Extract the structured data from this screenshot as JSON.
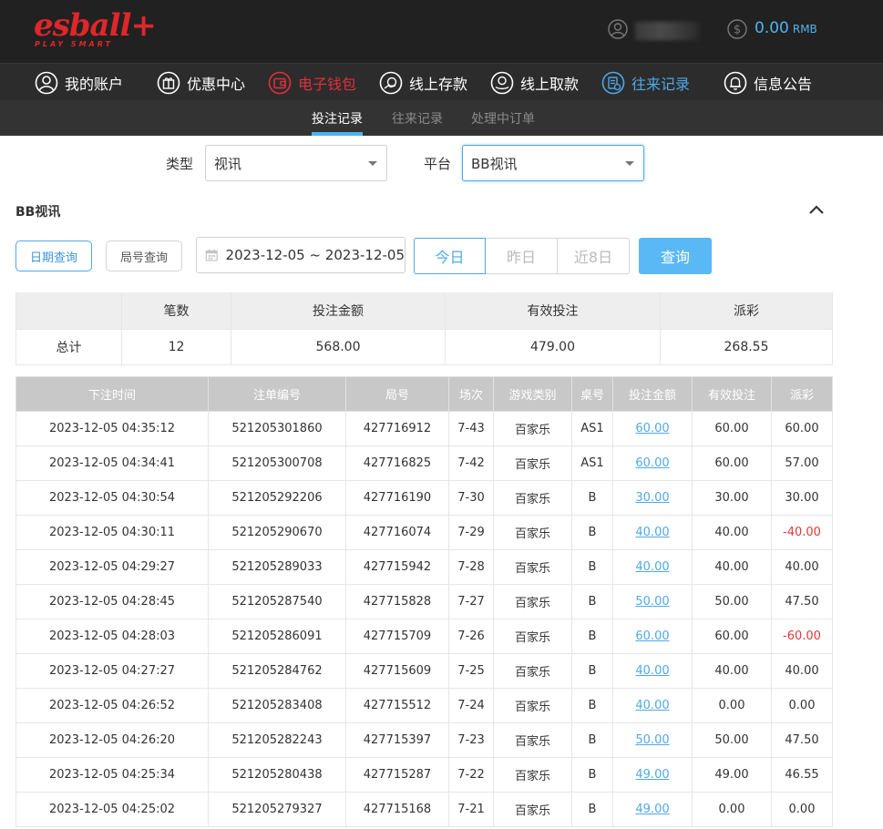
{
  "header": {
    "logo_main": "esball+",
    "logo_sub": "PLAY SMART",
    "balance": "0.00",
    "currency": "RMB"
  },
  "nav": {
    "items": [
      {
        "label": "我的账户",
        "icon": "user-circle-icon"
      },
      {
        "label": "优惠中心",
        "icon": "gift-icon"
      },
      {
        "label": "电子钱包",
        "icon": "wallet-icon"
      },
      {
        "label": "线上存款",
        "icon": "deposit-icon"
      },
      {
        "label": "线上取款",
        "icon": "withdraw-icon"
      },
      {
        "label": "往来记录",
        "icon": "records-icon"
      },
      {
        "label": "信息公告",
        "icon": "bell-icon"
      }
    ]
  },
  "subnav": {
    "items": [
      {
        "label": "投注记录"
      },
      {
        "label": "往来记录"
      },
      {
        "label": "处理中订单"
      }
    ]
  },
  "filters": {
    "type_label": "类型",
    "type_value": "视讯",
    "platform_label": "平台",
    "platform_value": "BB视讯"
  },
  "section": {
    "title": "BB视讯"
  },
  "query": {
    "date_query": "日期查询",
    "round_query": "局号查询",
    "date_range": "2023-12-05 ~ 2023-12-05",
    "today": "今日",
    "yesterday": "昨日",
    "last8": "近8日",
    "submit": "查询"
  },
  "summary": {
    "headers": [
      "",
      "笔数",
      "投注金额",
      "有效投注",
      "派彩"
    ],
    "row": [
      "总计",
      "12",
      "568.00",
      "479.00",
      "268.55"
    ]
  },
  "detail": {
    "headers": [
      "下注时间",
      "注单编号",
      "局号",
      "场次",
      "游戏类别",
      "桌号",
      "投注金额",
      "有效投注",
      "派彩"
    ],
    "rows": [
      [
        "2023-12-05 04:35:12",
        "521205301860",
        "427716912",
        "7-43",
        "百家乐",
        "AS1",
        "60.00",
        "60.00",
        "60.00"
      ],
      [
        "2023-12-05 04:34:41",
        "521205300708",
        "427716825",
        "7-42",
        "百家乐",
        "AS1",
        "60.00",
        "60.00",
        "57.00"
      ],
      [
        "2023-12-05 04:30:54",
        "521205292206",
        "427716190",
        "7-30",
        "百家乐",
        "B",
        "30.00",
        "30.00",
        "30.00"
      ],
      [
        "2023-12-05 04:30:11",
        "521205290670",
        "427716074",
        "7-29",
        "百家乐",
        "B",
        "40.00",
        "40.00",
        "-40.00"
      ],
      [
        "2023-12-05 04:29:27",
        "521205289033",
        "427715942",
        "7-28",
        "百家乐",
        "B",
        "40.00",
        "40.00",
        "40.00"
      ],
      [
        "2023-12-05 04:28:45",
        "521205287540",
        "427715828",
        "7-27",
        "百家乐",
        "B",
        "50.00",
        "50.00",
        "47.50"
      ],
      [
        "2023-12-05 04:28:03",
        "521205286091",
        "427715709",
        "7-26",
        "百家乐",
        "B",
        "60.00",
        "60.00",
        "-60.00"
      ],
      [
        "2023-12-05 04:27:27",
        "521205284762",
        "427715609",
        "7-25",
        "百家乐",
        "B",
        "40.00",
        "40.00",
        "40.00"
      ],
      [
        "2023-12-05 04:26:52",
        "521205283408",
        "427715512",
        "7-24",
        "百家乐",
        "B",
        "40.00",
        "0.00",
        "0.00"
      ],
      [
        "2023-12-05 04:26:20",
        "521205282243",
        "427715397",
        "7-23",
        "百家乐",
        "B",
        "50.00",
        "50.00",
        "47.50"
      ],
      [
        "2023-12-05 04:25:34",
        "521205280438",
        "427715287",
        "7-22",
        "百家乐",
        "B",
        "49.00",
        "49.00",
        "46.55"
      ],
      [
        "2023-12-05 04:25:02",
        "521205279327",
        "427715168",
        "7-21",
        "百家乐",
        "B",
        "49.00",
        "0.00",
        "0.00"
      ]
    ]
  },
  "colors": {
    "brand_red": "#e0262b",
    "accent_blue": "#4fa8e8",
    "negative": "#e23a3a"
  }
}
